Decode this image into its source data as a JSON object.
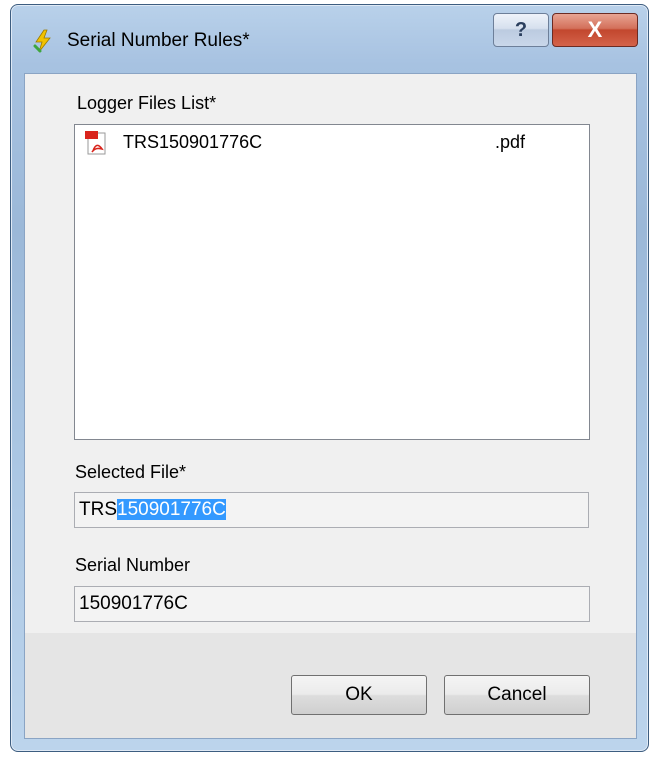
{
  "window": {
    "title": "Serial Number Rules*",
    "help_label": "?",
    "close_label": "X"
  },
  "logger_files": {
    "label": "Logger Files List*",
    "items": [
      {
        "name": "TRS150901776C",
        "extension": ".pdf",
        "icon": "pdf-icon"
      }
    ]
  },
  "selected_file": {
    "label": "Selected File*",
    "value_unselected": "TRS",
    "value_selected": "150901776C"
  },
  "serial_number": {
    "label": "Serial Number",
    "value": "150901776C"
  },
  "buttons": {
    "ok_label": "OK",
    "cancel_label": "Cancel"
  },
  "colors": {
    "selection": "#3399ff",
    "close_button": "#c2472e",
    "pdf_red": "#d9241c"
  }
}
